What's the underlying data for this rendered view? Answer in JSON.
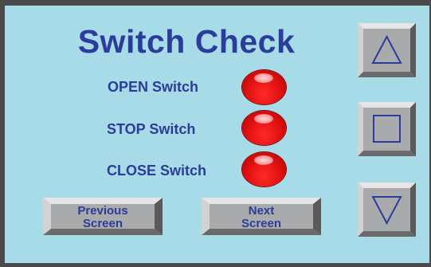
{
  "title": "Switch Check",
  "switches": [
    {
      "label": "OPEN Switch",
      "state_color": "#e01010"
    },
    {
      "label": "STOP Switch",
      "state_color": "#e01010"
    },
    {
      "label": "CLOSE Switch",
      "state_color": "#e01010"
    }
  ],
  "nav": {
    "previous": {
      "line1": "Previous",
      "line2": "Screen"
    },
    "next": {
      "line1": "Next",
      "line2": "Screen"
    }
  },
  "side_buttons": [
    {
      "icon": "triangle-up-icon"
    },
    {
      "icon": "square-icon"
    },
    {
      "icon": "triangle-down-icon"
    }
  ],
  "colors": {
    "background": "#a7dbe8",
    "text": "#2b3c9a",
    "lamp": "#e01010",
    "button": "#a9aaab"
  }
}
